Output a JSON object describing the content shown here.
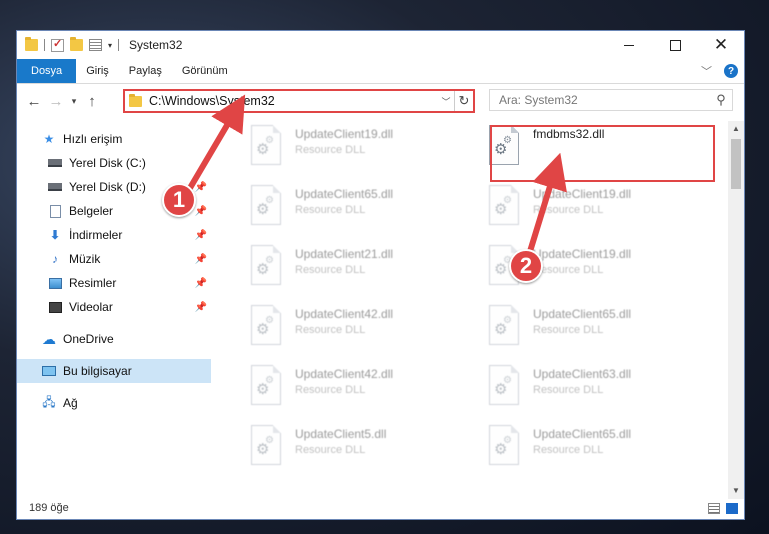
{
  "window": {
    "title": "System32"
  },
  "ribbon": {
    "tabs": [
      "Dosya",
      "Giriş",
      "Paylaş",
      "Görünüm"
    ]
  },
  "address": {
    "path": "C:\\Windows\\System32"
  },
  "search": {
    "placeholder": "Ara: System32"
  },
  "nav": {
    "items": [
      {
        "label": "Hızlı erişim",
        "icon": "star-icon"
      },
      {
        "label": "Yerel Disk (C:)",
        "icon": "drive-icon"
      },
      {
        "label": "Yerel Disk (D:)",
        "icon": "drive-icon"
      },
      {
        "label": "Belgeler",
        "icon": "document-icon"
      },
      {
        "label": "İndirmeler",
        "icon": "download-icon"
      },
      {
        "label": "Müzik",
        "icon": "music-icon"
      },
      {
        "label": "Resimler",
        "icon": "pictures-icon"
      },
      {
        "label": "Videolar",
        "icon": "videos-icon"
      },
      {
        "label": "OneDrive",
        "icon": "cloud-icon"
      },
      {
        "label": "Bu bilgisayar",
        "icon": "computer-icon"
      },
      {
        "label": "Ağ",
        "icon": "network-icon"
      }
    ]
  },
  "files": {
    "left": [
      {
        "name": "UpdateClient19.dll",
        "type": "Resource DLL"
      },
      {
        "name": "UpdateClient65.dll",
        "type": "Resource DLL"
      },
      {
        "name": "UpdateClient21.dll",
        "type": "Resource DLL"
      },
      {
        "name": "UpdateClient42.dll",
        "type": "Resource DLL"
      },
      {
        "name": "UpdateClient42.dll",
        "type": "Resource DLL"
      },
      {
        "name": "UpdateClient5.dll",
        "type": "Resource DLL"
      }
    ],
    "right": [
      {
        "name": "fmdbms32.dll",
        "type": ""
      },
      {
        "name": "UpdateClient19.dll",
        "type": "Resource DLL"
      },
      {
        "name": "UpdateClient19.dll",
        "type": "Resource DLL"
      },
      {
        "name": "UpdateClient65.dll",
        "type": "Resource DLL"
      },
      {
        "name": "UpdateClient63.dll",
        "type": "Resource DLL"
      },
      {
        "name": "UpdateClient65.dll",
        "type": "Resource DLL"
      }
    ]
  },
  "status": {
    "count": "189 öğe"
  },
  "annotations": {
    "step1": "1",
    "step2": "2"
  },
  "colors": {
    "accent": "#1979ca",
    "highlight": "#e04545",
    "selected": "#cce4f7"
  }
}
